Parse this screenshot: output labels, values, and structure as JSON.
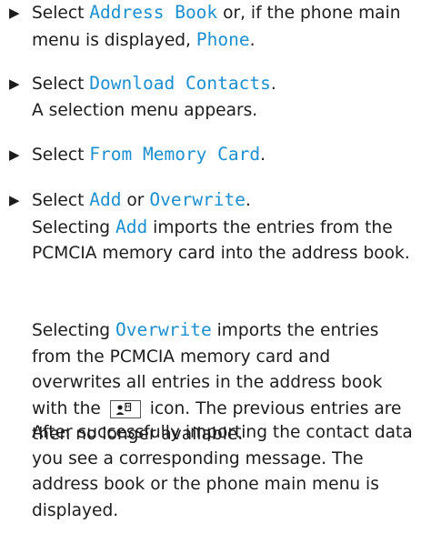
{
  "bullet_glyph": "▶",
  "accent_color": "#1b8fd0",
  "steps": [
    {
      "select": "Select ",
      "term": "Address Book",
      "mid": " or, if the phone main",
      "line2_text": "menu is displayed, ",
      "term2": "Phone",
      "end": "."
    },
    {
      "select": "Select ",
      "term": "Download Contacts",
      "end": ".",
      "result": "A selection menu appears."
    },
    {
      "select": "Select ",
      "term": "From Memory Card",
      "end": "."
    },
    {
      "select": "Select ",
      "term": "Add",
      "mid": " or ",
      "term2": "Overwrite",
      "end": ".",
      "result_prefix": "Selecting ",
      "result_term": "Add",
      "result_rest": " imports the entries from the PCMCIA memory card into the address book."
    }
  ],
  "overwrite_para": {
    "prefix": "Selecting ",
    "term": "Overwrite",
    "rest1": " imports the entries from the PCMCIA memory card and overwrites all entries in the address book with the",
    "icon": "memory-card-icon",
    "rest2": " icon. The previous entries are then no longer available."
  },
  "final_para": "After successfully importing the contact data you see a corresponding message. The address book or the phone main menu is displayed."
}
